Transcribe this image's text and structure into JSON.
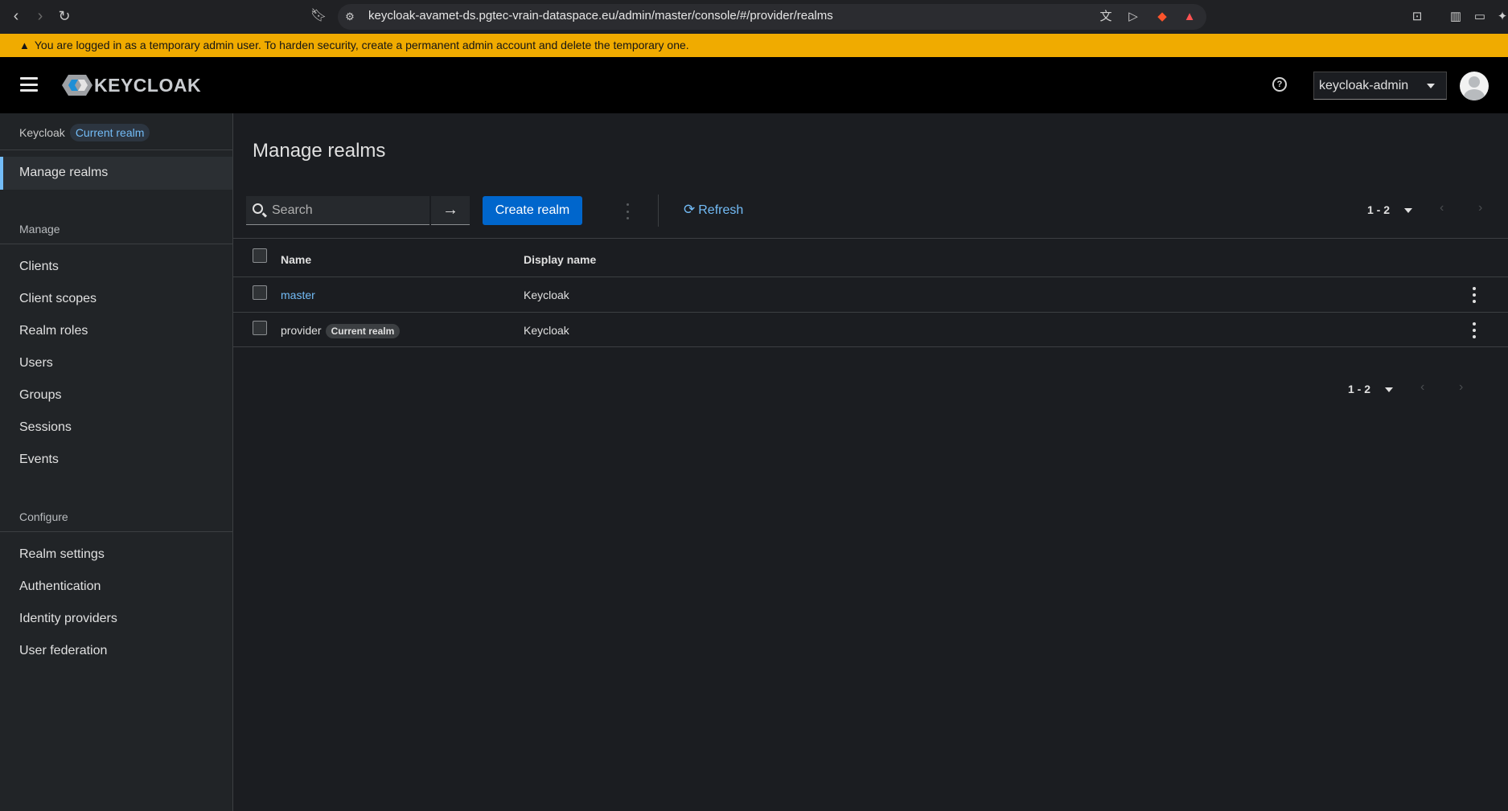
{
  "browser": {
    "url": "keycloak-avamet-ds.pgtec-vrain-dataspace.eu/admin/master/console/#/provider/realms"
  },
  "warning": {
    "text": "You are logged in as a temporary admin user. To harden security, create a permanent admin account and delete the temporary one."
  },
  "masthead": {
    "logo_text": "KEYCLOAK",
    "user": "keycloak-admin"
  },
  "sidebar": {
    "realm_name": "Keycloak",
    "realm_badge": "Current realm",
    "active_item": "Manage realms",
    "manage_heading": "Manage",
    "manage_items": [
      "Clients",
      "Client scopes",
      "Realm roles",
      "Users",
      "Groups",
      "Sessions",
      "Events"
    ],
    "configure_heading": "Configure",
    "configure_items": [
      "Realm settings",
      "Authentication",
      "Identity providers",
      "User federation"
    ]
  },
  "main": {
    "title": "Manage realms",
    "search_placeholder": "Search",
    "create_label": "Create realm",
    "refresh_label": "Refresh",
    "pagination_top": "1 - 2",
    "pagination_bottom": "1 - 2",
    "columns": [
      "Name",
      "Display name"
    ],
    "rows": [
      {
        "name": "master",
        "display_name": "Keycloak",
        "badge": ""
      },
      {
        "name": "provider",
        "display_name": "Keycloak",
        "badge": "Current realm"
      }
    ]
  },
  "colors": {
    "warning_bar": "#f0ab00",
    "primary_button": "#0066cc",
    "link": "#73bcf7"
  }
}
